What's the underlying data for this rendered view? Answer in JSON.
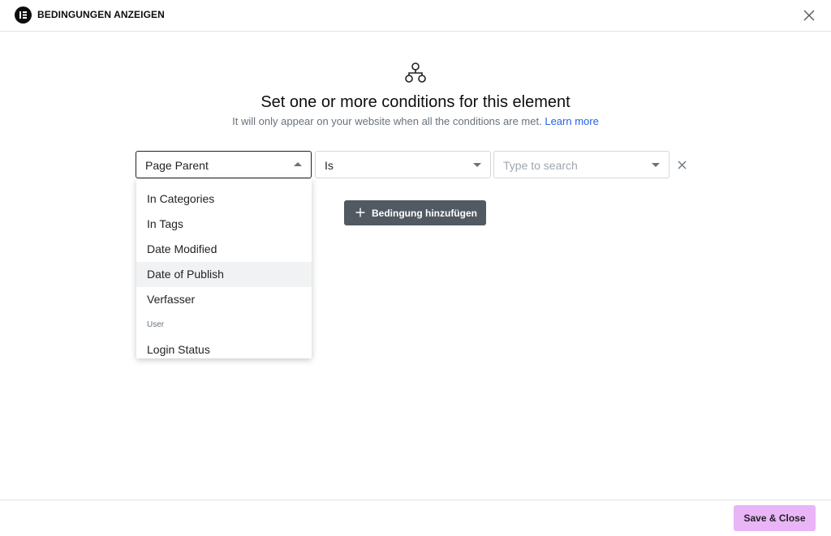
{
  "header": {
    "title": "BEDINGUNGEN ANZEIGEN",
    "logo_icon": "elementor-logo-icon",
    "close_icon": "close-icon"
  },
  "hero": {
    "icon": "sitemap-icon",
    "title": "Set one or more conditions for this element",
    "subtitle": "It will only appear on your website when all the conditions are met.",
    "link_text": "Learn more"
  },
  "condition_row": {
    "field_value": "Page Parent",
    "operator_value": "Is",
    "search_placeholder": "Type to search"
  },
  "add_button": {
    "label": "Bedingung hinzufügen"
  },
  "dropdown": {
    "items": [
      {
        "label": "In Categories"
      },
      {
        "label": "In Tags"
      },
      {
        "label": "Date Modified"
      },
      {
        "label": "Date of Publish",
        "highlighted": true
      },
      {
        "label": "Verfasser"
      }
    ],
    "group_user": "User",
    "item_after_group": "Login Status"
  },
  "footer": {
    "save_label": "Save & Close"
  },
  "colors": {
    "accent_save": "#e9b5f6",
    "add_button": "#515962",
    "link": "#2563eb"
  }
}
